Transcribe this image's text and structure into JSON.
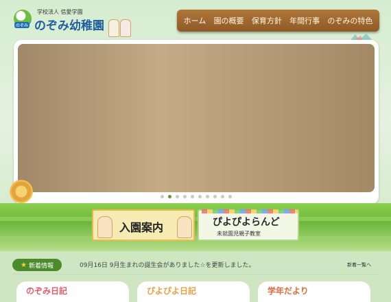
{
  "header": {
    "logo_subtitle": "学校法人 信愛学園",
    "logo_title": "のぞみ幼稚園",
    "logo_mark_text": "のぞみ"
  },
  "nav": {
    "items": [
      {
        "label": "ホーム"
      },
      {
        "label": "園の概要"
      },
      {
        "label": "保育方針"
      },
      {
        "label": "年間行事"
      },
      {
        "label": "のぞみの特色"
      }
    ]
  },
  "hero": {
    "slide_count": 10,
    "active_slide": 2
  },
  "banners": {
    "enrollment": {
      "label": "入園案内"
    },
    "piyopiyo": {
      "title": "ぴよぴよらんど",
      "subtitle": "未就園児親子教室"
    }
  },
  "news": {
    "badge_label": "新着情報",
    "entry": "09月16日 9月生まれの誕生会がありました☆を更新しました。",
    "more_link": "新着一覧へ"
  },
  "bottom_tabs": [
    {
      "label": "のぞみ日記",
      "color": "#e55a6a"
    },
    {
      "label": "ぴよぴよ日記",
      "color": "#e9a040"
    },
    {
      "label": "学年だより",
      "color": "#e06a3a"
    }
  ],
  "colors": {
    "nav_bg": "#a06a30",
    "news_badge": "#4c8b2b",
    "hat_yellow": "#f2cc1c",
    "grass": "#7cc244"
  }
}
